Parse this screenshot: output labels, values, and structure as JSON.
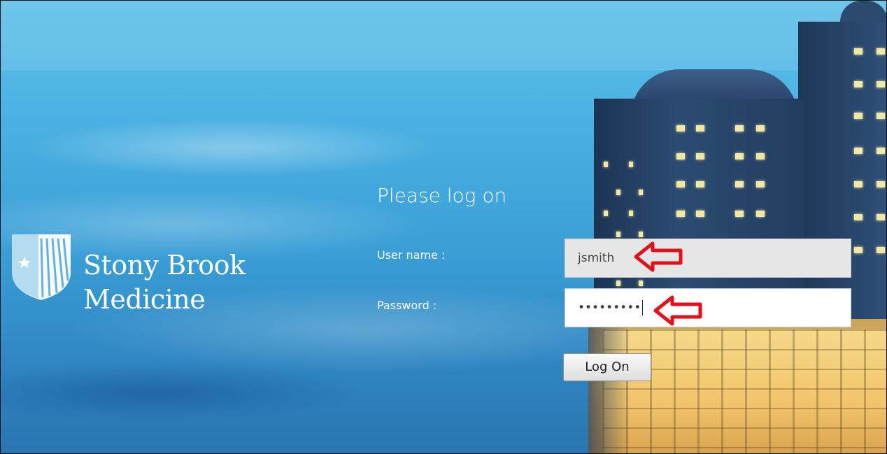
{
  "branding": {
    "name_line1": "Stony Brook",
    "name_line2": "Medicine"
  },
  "login": {
    "title": "Please log on",
    "username_label": "User name :",
    "username_value": "jsmith",
    "password_label": "Password :",
    "password_value": "•••••••••",
    "submit_label": "Log On"
  },
  "annotations": {
    "arrow_color": "#e0121b"
  },
  "colors": {
    "sky_top": "#5ec0e9",
    "sky_bottom": "#2a75b0"
  }
}
